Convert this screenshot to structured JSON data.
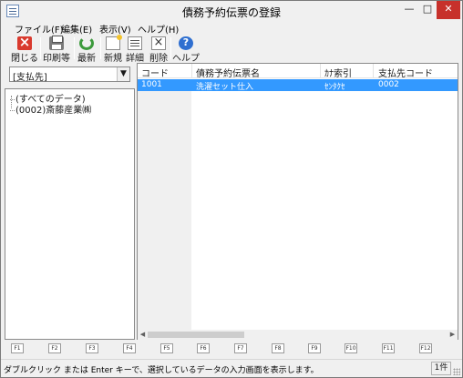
{
  "window": {
    "title": "債務予約伝票の登録",
    "icon": "document-icon"
  },
  "menu": [
    {
      "label": "ファイル(F)"
    },
    {
      "label": "編集(E)"
    },
    {
      "label": "表示(V)"
    },
    {
      "label": "ヘルプ(H)"
    }
  ],
  "toolbar": [
    {
      "label": "閉じる",
      "icon": "close-doc-icon"
    },
    {
      "label": "印刷等",
      "icon": "printer-icon"
    },
    {
      "label": "最新",
      "icon": "refresh-icon"
    },
    {
      "label": "新規",
      "icon": "new-doc-icon"
    },
    {
      "label": "詳細",
      "icon": "detail-icon"
    },
    {
      "label": "削除",
      "icon": "delete-icon"
    },
    {
      "label": "ヘルプ",
      "icon": "help-icon"
    }
  ],
  "filter": {
    "selected": "[支払先]"
  },
  "tree": [
    {
      "label": "(すべてのデータ)"
    },
    {
      "label": "(0002)斎藤産業㈱"
    }
  ],
  "list": {
    "columns": [
      "コード",
      "債務予約伝票名",
      "ｶﾅ索引",
      "支払先コード"
    ],
    "rows": [
      {
        "code": "1001",
        "name": "洗濯セット仕入",
        "kana": "ｾﾝﾀｸｾ",
        "payee": "0002"
      }
    ]
  },
  "fkeys": [
    "F1",
    "F2",
    "F3",
    "F4",
    "F5",
    "F6",
    "F7",
    "F8",
    "F9",
    "F10",
    "F11",
    "F12"
  ],
  "status": {
    "message": "ダブルクリック または Enter キーで、選択しているデータの入力画面を表示します。",
    "count": "1件"
  },
  "colors": {
    "selection": "#3399ff",
    "close_button": "#c7312b"
  }
}
